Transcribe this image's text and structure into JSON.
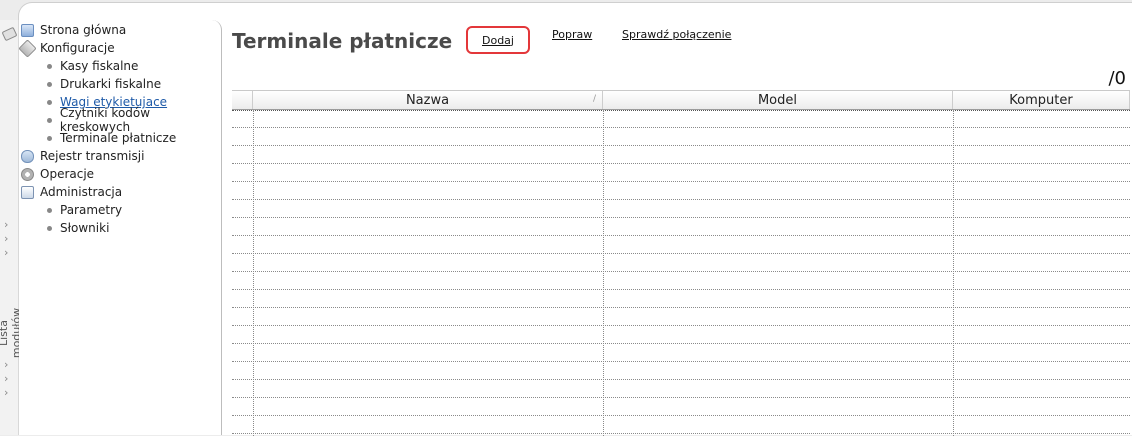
{
  "side_panel": {
    "label": "Lista modułów"
  },
  "nav": {
    "items": [
      {
        "label": "Strona główna",
        "icon": "home-icon"
      },
      {
        "label": "Konfiguracje",
        "icon": "settings-icon"
      },
      {
        "label": "Rejestr transmisji",
        "icon": "register-icon"
      },
      {
        "label": "Operacje",
        "icon": "gear-icon"
      },
      {
        "label": "Administracja",
        "icon": "admin-icon"
      }
    ],
    "konfiguracje_sub": [
      {
        "label": "Kasy fiskalne"
      },
      {
        "label": "Drukarki fiskalne"
      },
      {
        "label": "Wagi etykietujace"
      },
      {
        "label": "Czytniki kodów kreskowych"
      },
      {
        "label": "Terminale płatnicze"
      }
    ],
    "administracja_sub": [
      {
        "label": "Parametry"
      },
      {
        "label": "Słowniki"
      }
    ]
  },
  "page": {
    "title": "Terminale płatnicze",
    "counter": "/0"
  },
  "actions": {
    "add": "Dodaj",
    "edit": "Popraw",
    "check": "Sprawdź połączenie"
  },
  "table": {
    "columns": [
      "Nazwa",
      "Model",
      "Komputer"
    ],
    "rows": []
  },
  "colors": {
    "highlight": "#e3373a",
    "link": "#1e5aa8"
  }
}
